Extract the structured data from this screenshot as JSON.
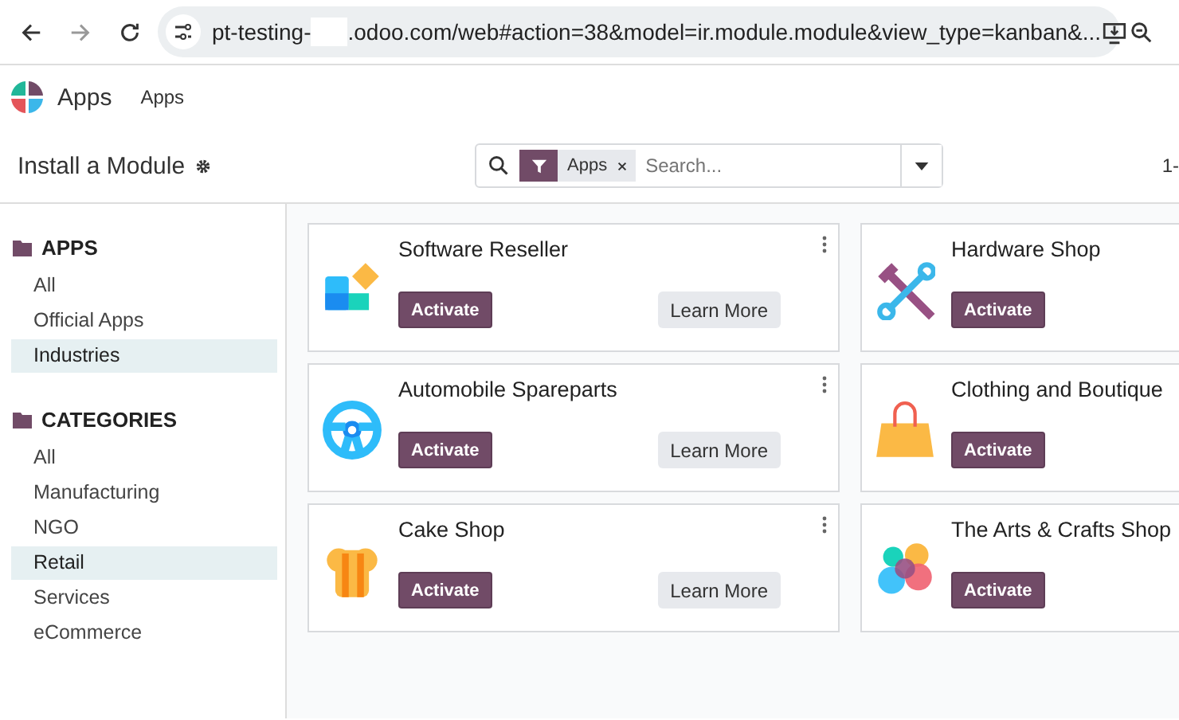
{
  "browser": {
    "url_start": "pt-testing-",
    "url_end": ".odoo.com/web#action=38&model=ir.module.module&view_type=kanban&..."
  },
  "navbar": {
    "app_name": "Apps",
    "menu": [
      "Apps"
    ]
  },
  "control_panel": {
    "title": "Install a Module",
    "facet": "Apps",
    "placeholder": "Search...",
    "pager": "1-"
  },
  "sidebar": [
    {
      "heading": "APPS",
      "items": [
        {
          "label": "All",
          "selected": false
        },
        {
          "label": "Official Apps",
          "selected": false
        },
        {
          "label": "Industries",
          "selected": true
        }
      ]
    },
    {
      "heading": "CATEGORIES",
      "items": [
        {
          "label": "All",
          "selected": false
        },
        {
          "label": "Manufacturing",
          "selected": false
        },
        {
          "label": "NGO",
          "selected": false
        },
        {
          "label": "Retail",
          "selected": true
        },
        {
          "label": "Services",
          "selected": false
        },
        {
          "label": "eCommerce",
          "selected": false
        }
      ]
    }
  ],
  "cards": [
    {
      "name": "Software Reseller",
      "activate": "Activate",
      "learn_more": "Learn More"
    },
    {
      "name": "Hardware Shop",
      "activate": "Activate"
    },
    {
      "name": "Automobile Spareparts",
      "activate": "Activate",
      "learn_more": "Learn More"
    },
    {
      "name": "Clothing and Boutique",
      "activate": "Activate"
    },
    {
      "name": "Cake Shop",
      "activate": "Activate",
      "learn_more": "Learn More"
    },
    {
      "name": "The Arts & Crafts Shop",
      "activate": "Activate"
    }
  ]
}
